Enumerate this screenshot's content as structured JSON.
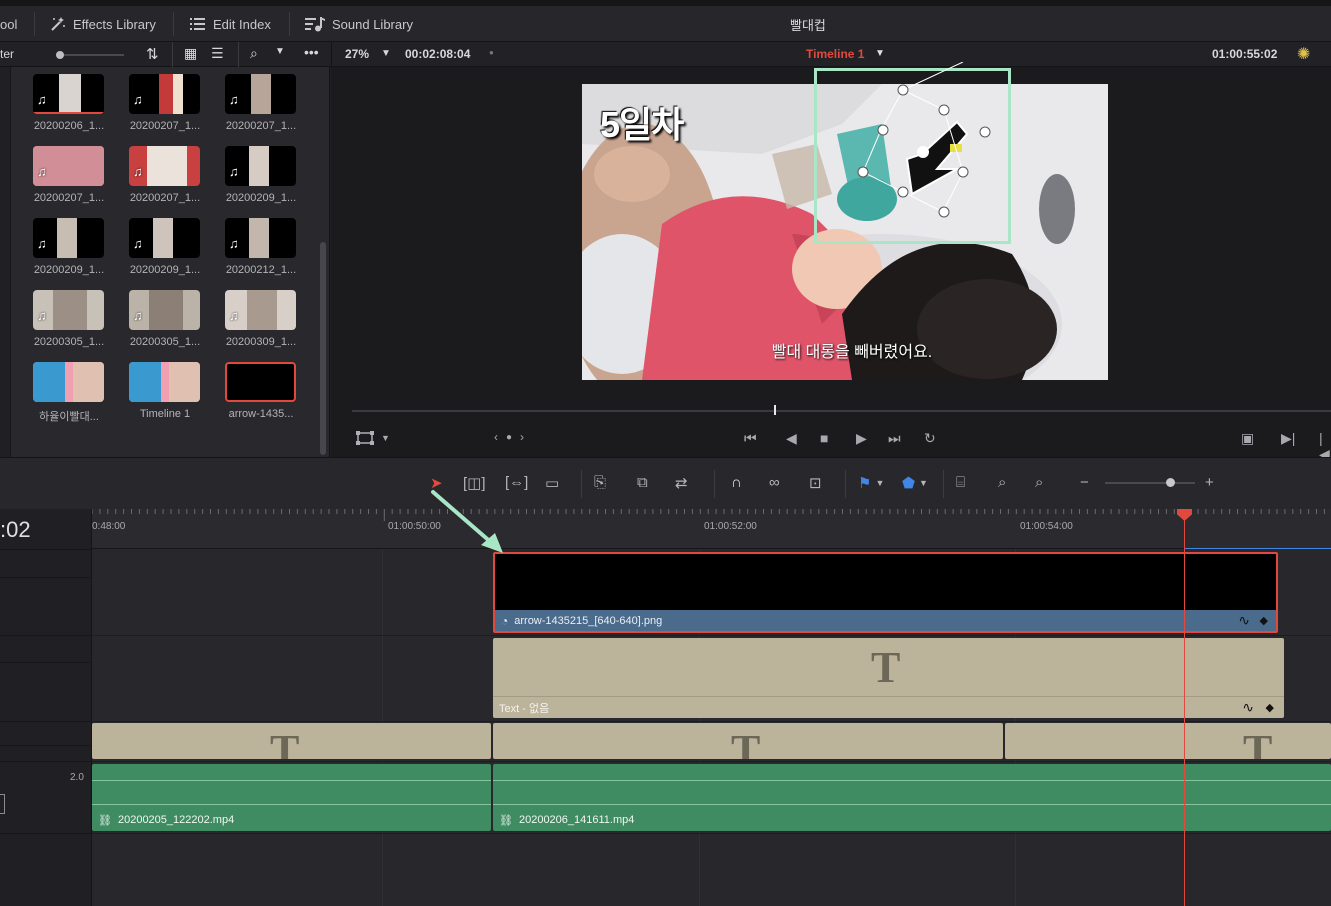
{
  "toolbar": {
    "media_pool_label": "ool",
    "effects_library": "Effects Library",
    "edit_index": "Edit Index",
    "sound_library": "Sound Library",
    "project_title": "빨대컵"
  },
  "subbar": {
    "filter_label": "ter",
    "zoom": "27%",
    "source_timecode": "00:02:08:04",
    "timeline_name": "Timeline 1",
    "record_timecode": "01:00:55:02"
  },
  "media_pool": {
    "clips": [
      {
        "label": "20200206_1..."
      },
      {
        "label": "20200207_1..."
      },
      {
        "label": "20200207_1..."
      },
      {
        "label": "20200207_1..."
      },
      {
        "label": "20200207_1..."
      },
      {
        "label": "20200209_1..."
      },
      {
        "label": "20200209_1..."
      },
      {
        "label": "20200209_1..."
      },
      {
        "label": "20200212_1..."
      },
      {
        "label": "20200305_1..."
      },
      {
        "label": "20200305_1..."
      },
      {
        "label": "20200309_1..."
      },
      {
        "label": "하율이빨대..."
      },
      {
        "label": "Timeline 1"
      },
      {
        "label": "arrow-1435..."
      }
    ]
  },
  "viewer": {
    "overlay_title": "5일차",
    "subtitle": "빨대 대롱을 빼버렸어요."
  },
  "timeline": {
    "timecode": ":02",
    "ruler": [
      "0:48:00",
      "01:00:50:00",
      "01:00:52:00",
      "01:00:54:00"
    ],
    "audio_level": "2.0",
    "clips": {
      "arrow_png": "arrow-1435215_[640-640].png",
      "text_clip": "Text - 없음",
      "title_glyph": "T",
      "audio_left": "20200205_122202.mp4",
      "audio_right": "20200206_141611.mp4"
    }
  },
  "colors": {
    "accent_red": "#e2493e",
    "title_clip": "#bcb39b",
    "audio_clip": "#3f8c62",
    "video_footer": "#4b6b8c",
    "annotation": "#a8e6c6"
  }
}
